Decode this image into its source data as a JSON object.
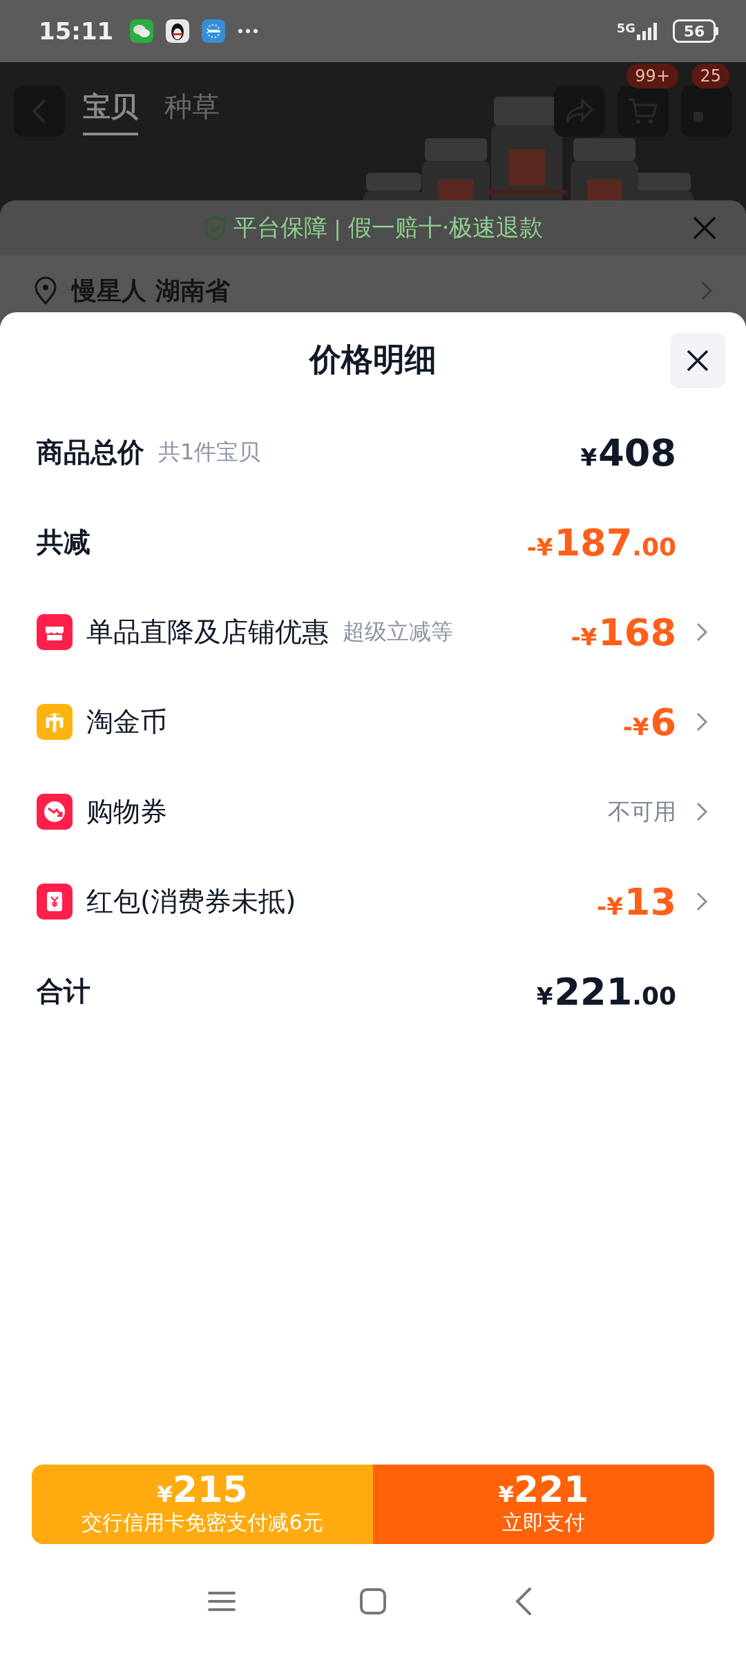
{
  "status_bar": {
    "time": "15:11",
    "network": "5G",
    "battery": "56"
  },
  "header": {
    "tabs": [
      {
        "label": "宝贝",
        "selected": true
      },
      {
        "label": "种草",
        "selected": false
      }
    ],
    "badges": [
      "99+",
      "25"
    ]
  },
  "guarantee": {
    "title": "平台保障",
    "separator": "|",
    "text": "假一赔十·极速退款"
  },
  "address": {
    "text": "慢星人 湖南省"
  },
  "sheet": {
    "title": "价格明细",
    "rows": [
      {
        "kind": "plain",
        "label": "商品总价",
        "note": "共1件宝贝",
        "value": {
          "kind": "price",
          "prefix": "¥",
          "amount": "408"
        }
      },
      {
        "kind": "plain",
        "label": "共减",
        "value": {
          "kind": "discount",
          "prefix": "-¥",
          "amount": "187",
          "cents": ".00"
        }
      },
      {
        "kind": "shop",
        "label": "单品直降及店铺优惠",
        "note": "超级立减等",
        "value": {
          "kind": "discount",
          "prefix": "-¥",
          "amount": "168"
        }
      },
      {
        "kind": "coin",
        "label": "淘金币",
        "value": {
          "kind": "discount",
          "prefix": "-¥",
          "amount": "6"
        }
      },
      {
        "kind": "coupon",
        "label": "购物券",
        "value": {
          "kind": "status",
          "text": "不可用"
        }
      },
      {
        "kind": "envelope",
        "label": "红包(消费券未抵)",
        "value": {
          "kind": "discount",
          "prefix": "-¥",
          "amount": "13"
        }
      },
      {
        "kind": "plain",
        "label": "合计",
        "value": {
          "kind": "price",
          "prefix": "¥",
          "amount": "221",
          "cents": ".00"
        }
      }
    ],
    "pay_buttons": [
      {
        "kind": "card",
        "currency": "¥",
        "amount": "215",
        "caption": "交行信用卡免密支付减6元"
      },
      {
        "kind": "pay",
        "currency": "¥",
        "amount": "221",
        "caption": "立即支付"
      }
    ]
  }
}
